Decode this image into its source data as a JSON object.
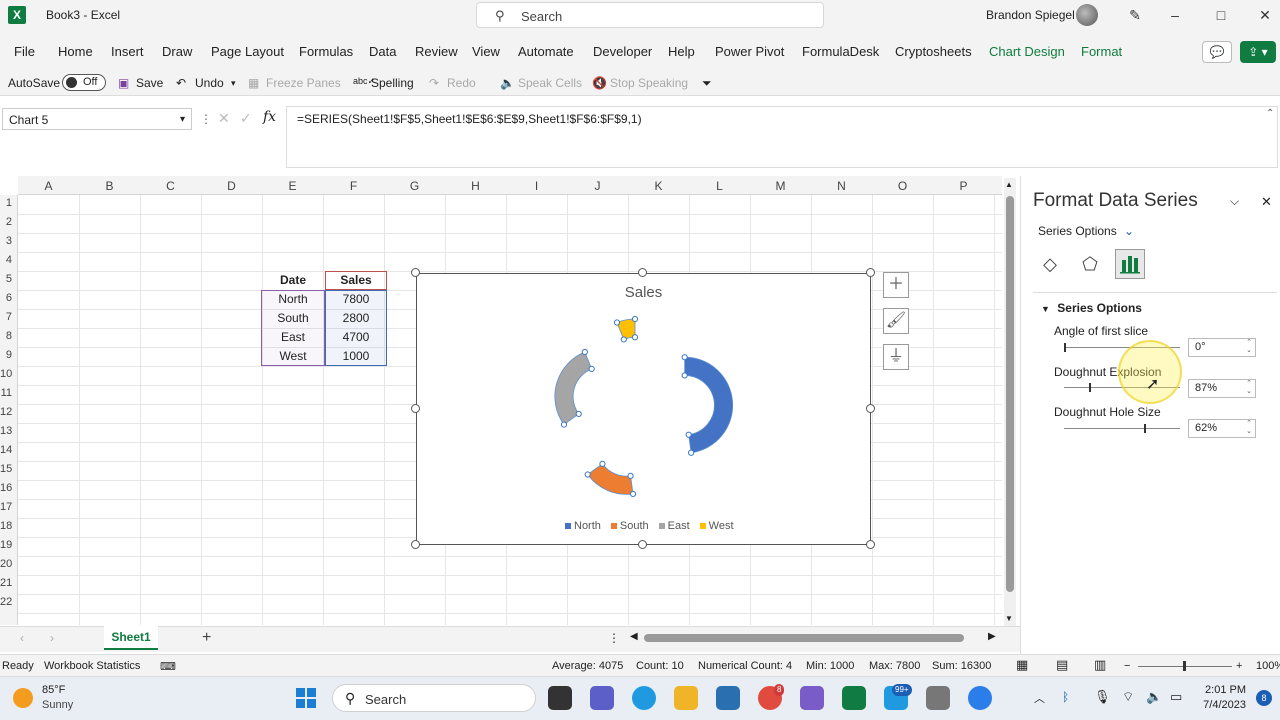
{
  "window": {
    "title": "Book3  -  Excel",
    "search_placeholder": "Search",
    "user_name": "Brandon Spiegel",
    "minimize": "–",
    "maximize": "□",
    "close": "✕"
  },
  "ribbon": {
    "tabs": [
      "File",
      "Home",
      "Insert",
      "Draw",
      "Page Layout",
      "Formulas",
      "Data",
      "Review",
      "View",
      "Automate",
      "Developer",
      "Help",
      "Power Pivot",
      "FormulaDesk",
      "Cryptosheets",
      "Chart Design",
      "Format"
    ]
  },
  "qat": {
    "autosave_label": "AutoSave",
    "autosave_state": "Off",
    "save": "Save",
    "undo": "Undo",
    "freeze_panes": "Freeze Panes",
    "spelling": "Spelling",
    "redo": "Redo",
    "speak_cells": "Speak Cells",
    "stop_speaking": "Stop Speaking"
  },
  "formula_bar": {
    "name_box": "Chart 5",
    "fx": "fx",
    "formula": "=SERIES(Sheet1!$F$5,Sheet1!$E$6:$E$9,Sheet1!$F$6:$F$9,1)"
  },
  "grid": {
    "columns": [
      "A",
      "B",
      "C",
      "D",
      "E",
      "F",
      "G",
      "H",
      "I",
      "J",
      "K",
      "L",
      "M",
      "N",
      "O",
      "P"
    ],
    "rows": [
      "1",
      "2",
      "3",
      "4",
      "5",
      "6",
      "7",
      "8",
      "9",
      "10",
      "11",
      "12",
      "13",
      "14",
      "15",
      "16",
      "17",
      "18",
      "19",
      "20",
      "21",
      "22"
    ]
  },
  "table": {
    "header_date": "Date",
    "header_sales": "Sales",
    "rows": [
      {
        "date": "North",
        "sales": "7800"
      },
      {
        "date": "South",
        "sales": "2800"
      },
      {
        "date": "East",
        "sales": "4700"
      },
      {
        "date": "West",
        "sales": "1000"
      }
    ]
  },
  "chart_data": {
    "type": "doughnut",
    "title": "Sales",
    "categories": [
      "North",
      "South",
      "East",
      "West"
    ],
    "values": [
      7800,
      2800,
      4700,
      1000
    ],
    "colors": [
      "#4472c4",
      "#ed7d31",
      "#a5a5a5",
      "#ffc000"
    ],
    "first_slice_angle_deg": 0,
    "explosion_pct": 87,
    "hole_size_pct": 62,
    "legend_position": "bottom"
  },
  "sheets": {
    "active": "Sheet1",
    "add": "+"
  },
  "status": {
    "ready": "Ready",
    "workbook_stats": "Workbook Statistics",
    "average": "Average: 4075",
    "count": "Count: 10",
    "numerical_count": "Numerical Count: 4",
    "min": "Min: 1000",
    "max": "Max: 7800",
    "sum": "Sum: 16300",
    "zoom": "100%"
  },
  "pane": {
    "title": "Format Data Series",
    "subtitle": "Series Options",
    "section": "Series Options",
    "angle_label": "Angle of first slice",
    "angle_value": "0°",
    "explosion_label": "Doughnut Explosion",
    "explosion_value": "87%",
    "hole_label": "Doughnut Hole Size",
    "hole_value": "62%"
  },
  "taskbar": {
    "temp": "85°F",
    "weather": "Sunny",
    "search": "Search",
    "time": "2:01 PM",
    "date": "7/4/2023",
    "chrome_badge": "8",
    "app_badge": "99+",
    "notifications": "8"
  }
}
